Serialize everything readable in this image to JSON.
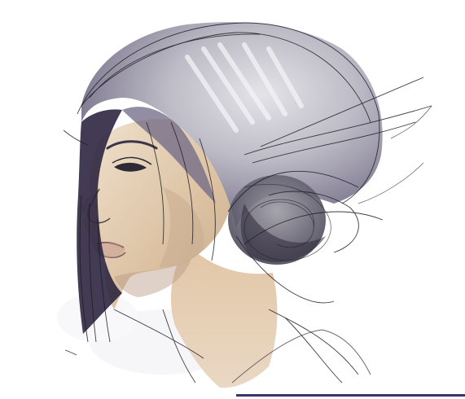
{
  "artwork": {
    "subject": "sketch-portrait-profile",
    "colors": {
      "background": "#ffffff",
      "hair_light": "#d8d8dc",
      "hair_mid": "#9a97a6",
      "hair_dark": "#5e5870",
      "hair_shadow": "#2a2440",
      "skin_light": "#eedcc8",
      "skin_mid": "#d9bfa0",
      "skin_shadow": "#b89a86",
      "line": "#1c1c22",
      "bottom_rule": "#3b3668"
    }
  }
}
